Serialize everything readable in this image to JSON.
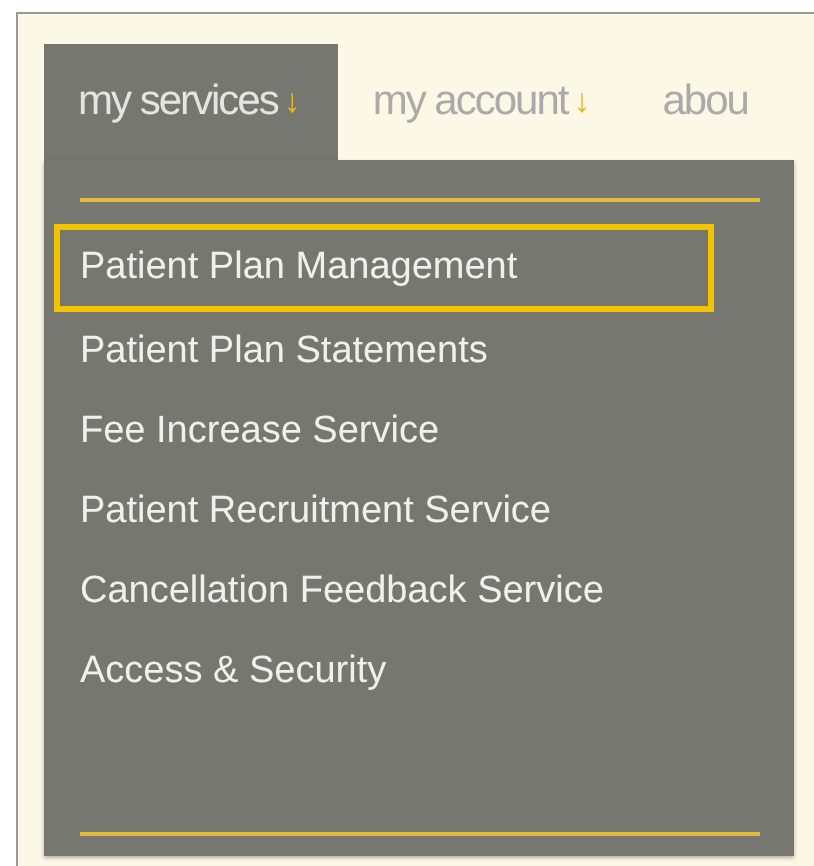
{
  "nav": {
    "tabs": [
      {
        "label": "my services",
        "arrow": "↓",
        "selected": true
      },
      {
        "label": "my account",
        "arrow": "↓",
        "selected": false
      },
      {
        "label": "abou",
        "selected": false
      }
    ]
  },
  "menu": {
    "items": [
      {
        "label": "Patient Plan Management",
        "selected": true
      },
      {
        "label": "Patient Plan Statements",
        "selected": false
      },
      {
        "label": "Fee Increase Service",
        "selected": false
      },
      {
        "label": "Patient Recruitment Service",
        "selected": false
      },
      {
        "label": "Cancellation Feedback Service",
        "selected": false
      },
      {
        "label": "Access & Security",
        "selected": false
      }
    ]
  }
}
